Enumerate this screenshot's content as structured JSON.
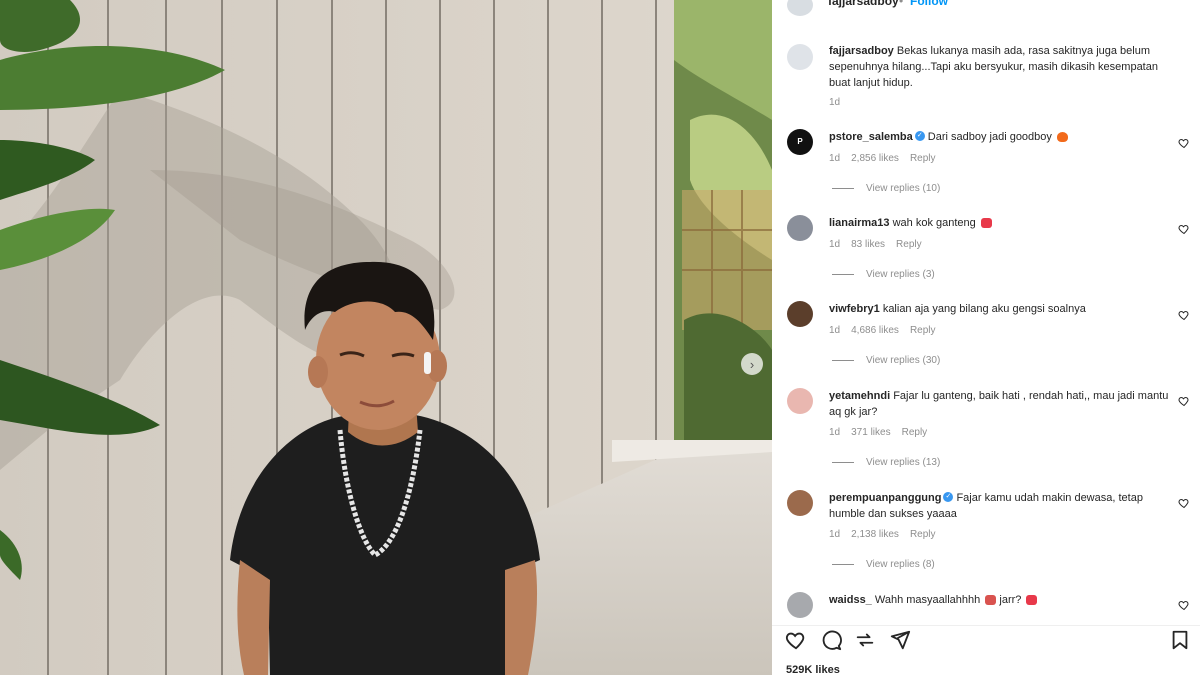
{
  "post": {
    "author": "fajjarsadboy",
    "separator": "•",
    "follow_label": "Follow",
    "more_label": "···",
    "caption_text": "Bekas lukanya masih ada, rasa sakitnya juga belum sepenuhnya hilang...Tapi aku bersyukur, masih dikasih kesempatan buat lanjut hidup.",
    "caption_time": "1d",
    "likes_count": "529K likes"
  },
  "comments": [
    {
      "user": "pstore_salemba",
      "verified": true,
      "text": "Dari sadboy jadi goodboy",
      "emoji": "fire-emoji",
      "time": "1d",
      "likes": "2,856 likes",
      "reply_label": "Reply",
      "view_replies": "View replies (10)"
    },
    {
      "user": "lianairma13",
      "verified": false,
      "text": "wah kok ganteng",
      "emoji": "heart-eyes-emoji",
      "time": "1d",
      "likes": "83 likes",
      "reply_label": "Reply",
      "view_replies": "View replies (3)"
    },
    {
      "user": "viwfebry1",
      "verified": false,
      "text": "kalian aja yang bilang aku gengsi soalnya",
      "emoji": "",
      "time": "1d",
      "likes": "4,686 likes",
      "reply_label": "Reply",
      "view_replies": "View replies (30)"
    },
    {
      "user": "yetamehndi",
      "verified": false,
      "text": "Fajar lu ganteng, baik hati , rendah hati,, mau jadi mantu aq gk jar?",
      "emoji": "",
      "time": "1d",
      "likes": "371 likes",
      "reply_label": "Reply",
      "view_replies": "View replies (13)"
    },
    {
      "user": "perempuanpanggung",
      "verified": true,
      "text": "Fajar kamu udah makin dewasa, tetap humble dan sukses yaaaa",
      "emoji": "",
      "time": "1d",
      "likes": "2,138 likes",
      "reply_label": "Reply",
      "view_replies": "View replies (8)"
    },
    {
      "user": "waidss_",
      "verified": false,
      "text": "Wahh masyaallahhhh",
      "text2": "jarr?",
      "emoji": "heart-eyes-emoji",
      "time": "",
      "likes": "",
      "reply_label": "",
      "view_replies": ""
    }
  ],
  "colors": {
    "accent": "#0095f6",
    "muted": "#8e8e8e",
    "verified": "#3897f0"
  },
  "icons": [
    "heart-icon",
    "comment-icon",
    "share-icon",
    "send-icon",
    "bookmark-icon",
    "chevron-right-icon"
  ]
}
